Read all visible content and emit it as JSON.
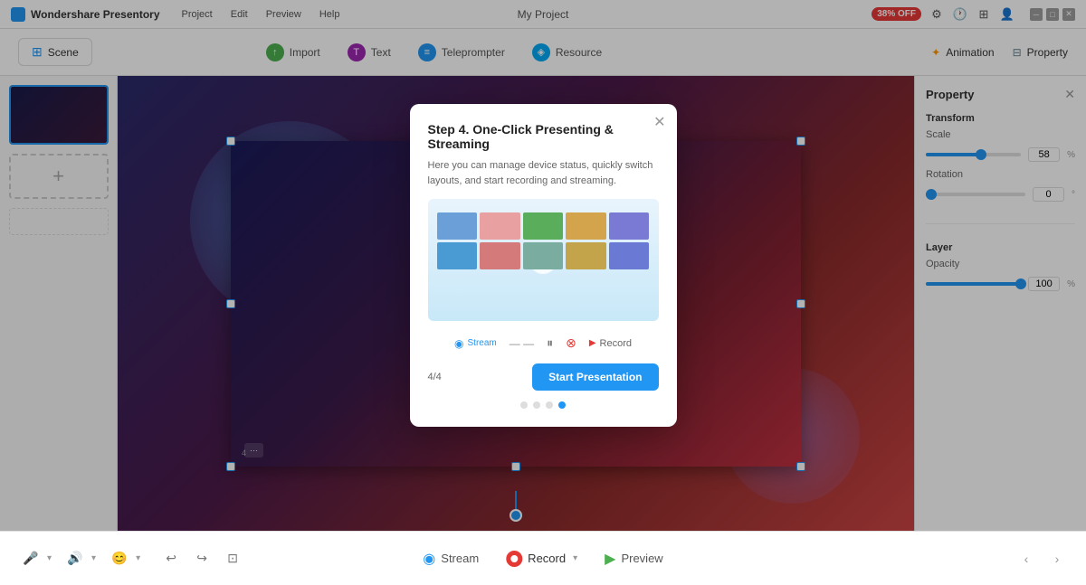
{
  "app": {
    "name": "Wondershare Presentory",
    "project_name": "My Project",
    "discount_badge": "38% OFF"
  },
  "menu": {
    "items": [
      "Project",
      "Edit",
      "Preview",
      "Help"
    ]
  },
  "toolbar": {
    "scene_label": "Scene",
    "import_label": "Import",
    "text_label": "Text",
    "teleprompter_label": "Teleprompter",
    "resource_label": "Resource",
    "animation_label": "Animation",
    "property_label": "Property"
  },
  "property_panel": {
    "title": "Property",
    "transform_label": "Transform",
    "scale_label": "Scale",
    "scale_value": "58",
    "scale_unit": "%",
    "rotation_label": "Rotation",
    "rotation_value": "0",
    "rotation_unit": "°",
    "layer_label": "Layer",
    "opacity_label": "Opacity",
    "opacity_value": "100",
    "opacity_unit": "%"
  },
  "modal": {
    "title": "Step 4. One-Click Presenting & Streaming",
    "description": "Here you can manage device status, quickly switch layouts, and start recording and streaming.",
    "progress": "4/4",
    "start_button": "Start Presentation",
    "stream_label": "Stream",
    "pause_label": "⏸",
    "settings_label": "⚙",
    "record_label": "● Record"
  },
  "bottom_bar": {
    "stream_label": "Stream",
    "record_label": "Record",
    "preview_label": "Preview"
  },
  "slide": {
    "nav_label": "4",
    "total_slides": "4"
  }
}
